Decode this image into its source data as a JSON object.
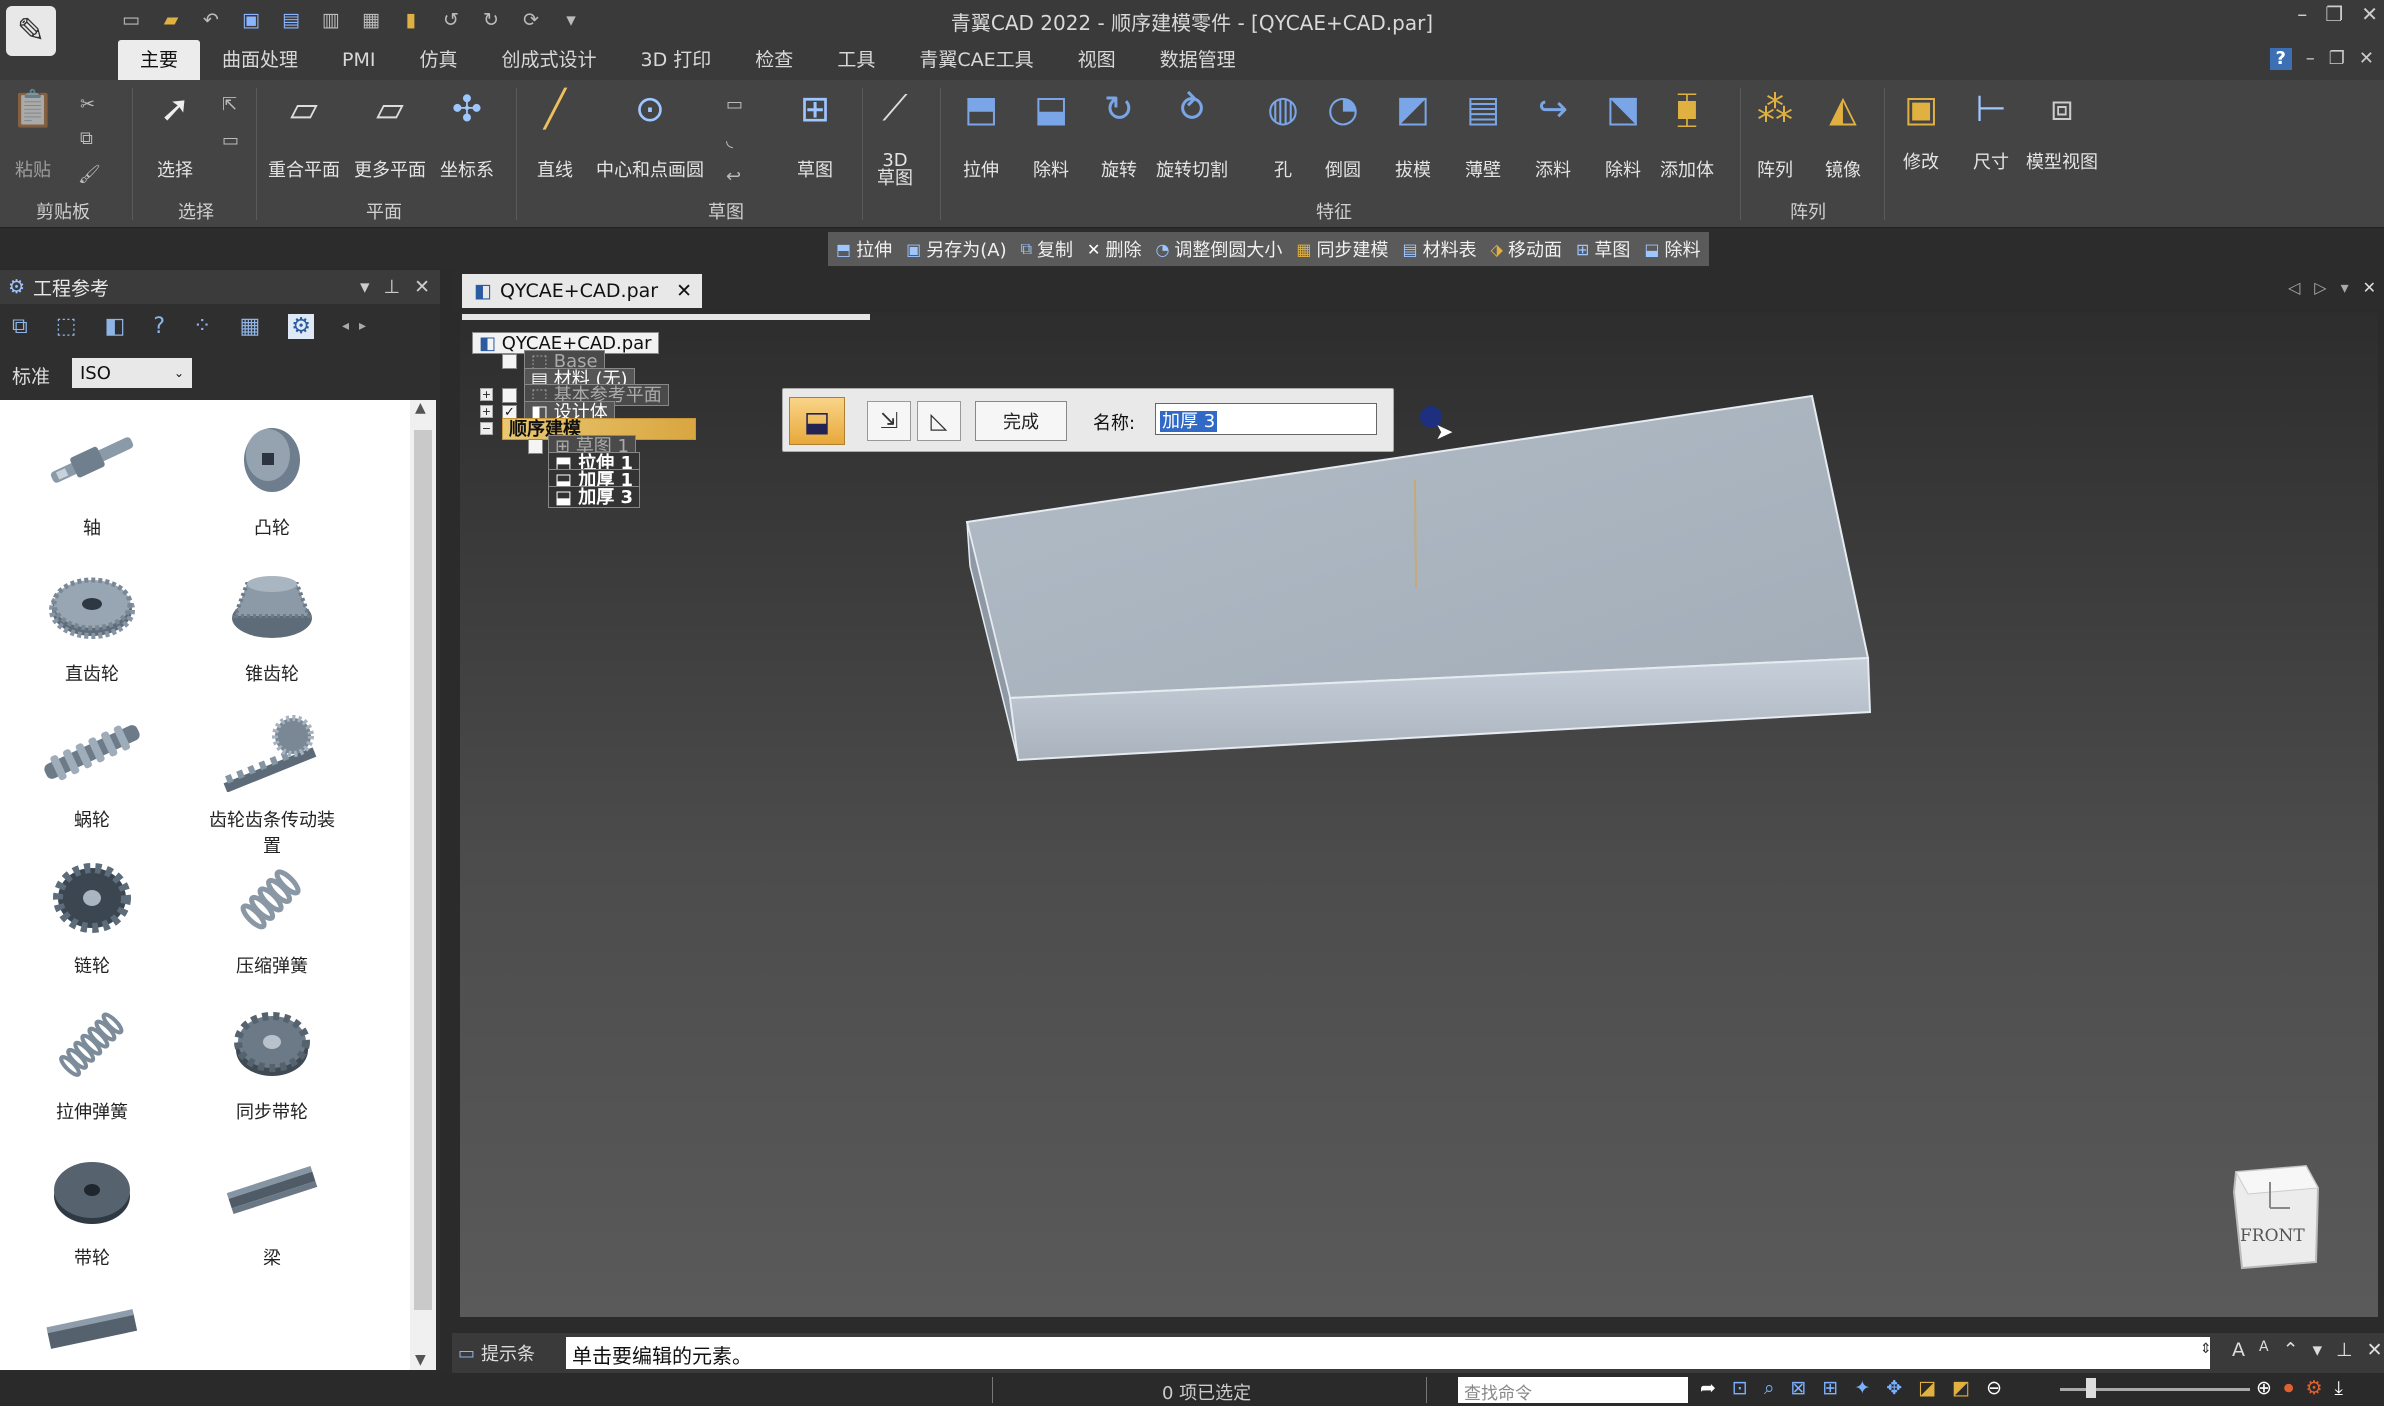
{
  "window": {
    "title": "青翼CAD 2022 - 顺序建模零件 - [QYCAE+CAD.par]",
    "controls": [
      "–",
      "❐",
      "✕"
    ]
  },
  "ribbon_tabs": [
    "主要",
    "曲面处理",
    "PMI",
    "仿真",
    "创成式设计",
    "3D 打印",
    "检查",
    "工具",
    "青翼CAE工具",
    "视图",
    "数据管理"
  ],
  "ribbon": {
    "paste": "粘贴",
    "select": "选择",
    "coincident_plane": "重合平面",
    "more_planes": "更多平面",
    "coord_sys": "坐标系",
    "line": "直线",
    "center_circle": "中心和点画圆",
    "sketch": "草图",
    "sketch3d": "3D\n草图",
    "extrude": "拉伸",
    "cut": "除料",
    "revolve": "旋转",
    "revolve_cut": "旋转切割",
    "hole": "孔",
    "chamfer": "倒圆",
    "draft": "拔模",
    "thin_wall": "薄壁",
    "add_material": "添料",
    "remove_material": "除料",
    "add_body": "添加体",
    "pattern": "阵列",
    "mirror": "镜像",
    "modify": "修改",
    "dimension": "尺寸",
    "model_view": "模型视图",
    "groups": {
      "clipboard": "剪贴板",
      "select": "选择",
      "plane": "平面",
      "sketch": "草图",
      "feature": "特征",
      "pattern": "阵列"
    }
  },
  "command_bar": [
    "拉伸",
    "另存为(A)",
    "复制",
    "删除",
    "调整倒圆大小",
    "同步建模",
    "材料表",
    "移动面",
    "草图",
    "除料"
  ],
  "left_panel": {
    "title": "工程参考",
    "standard_label": "标准",
    "standard_value": "ISO",
    "parts": [
      "轴",
      "凸轮",
      "直齿轮",
      "锥齿轮",
      "蜗轮",
      "齿轮齿条传动装置",
      "链轮",
      "压缩弹簧",
      "拉伸弹簧",
      "同步带轮",
      "带轮",
      "梁"
    ]
  },
  "document": {
    "tab": "QYCAE+CAD.par",
    "tree": {
      "root": "QYCAE+CAD.par",
      "base": "Base",
      "material": "材料 (无)",
      "ref_planes": "基本参考平面",
      "design_body": "设计体",
      "sequential": "顺序建模",
      "sketch1": "草图 1",
      "extrude1": "拉伸 1",
      "thicken1": "加厚 1",
      "thicken3": "加厚 3"
    }
  },
  "quickbar": {
    "done": "完成",
    "name_label": "名称:",
    "name_value": "加厚 3"
  },
  "viewcube": {
    "label": "FRONT"
  },
  "statusbar": {
    "prompt_label": "提示条",
    "prompt_text": "单击要编辑的元素。",
    "selected_count": "0 项已选定",
    "search_placeholder": "查找命令"
  },
  "colors": {
    "ribbon_bg": "#444444",
    "model_face": "#b5bfca",
    "selection_highlight": "#e8c872"
  }
}
